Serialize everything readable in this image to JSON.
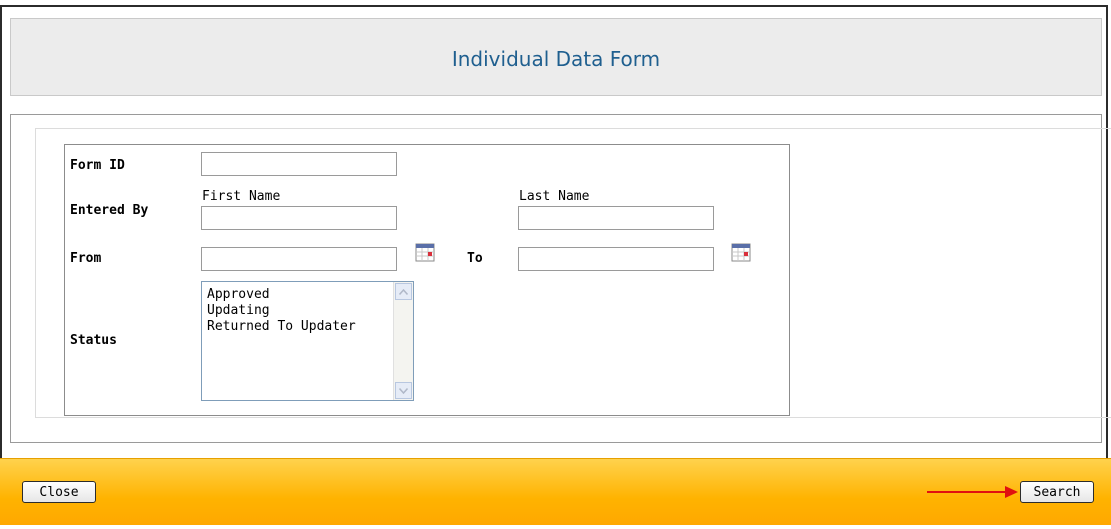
{
  "header": {
    "title": "Individual Data Form"
  },
  "form": {
    "form_id_label": "Form ID",
    "entered_by_label": "Entered By",
    "first_name_label": "First Name",
    "last_name_label": "Last Name",
    "from_label": "From",
    "to_label": "To",
    "status_label": "Status",
    "status_options": [
      "Approved",
      "Updating",
      "Returned To Updater"
    ]
  },
  "footer": {
    "close_label": "Close",
    "search_label": "Search"
  },
  "colors": {
    "title": "#1f5f8f",
    "footer_top": "#ffd24d",
    "footer_bottom": "#ffa800",
    "arrow": "#e01010"
  }
}
